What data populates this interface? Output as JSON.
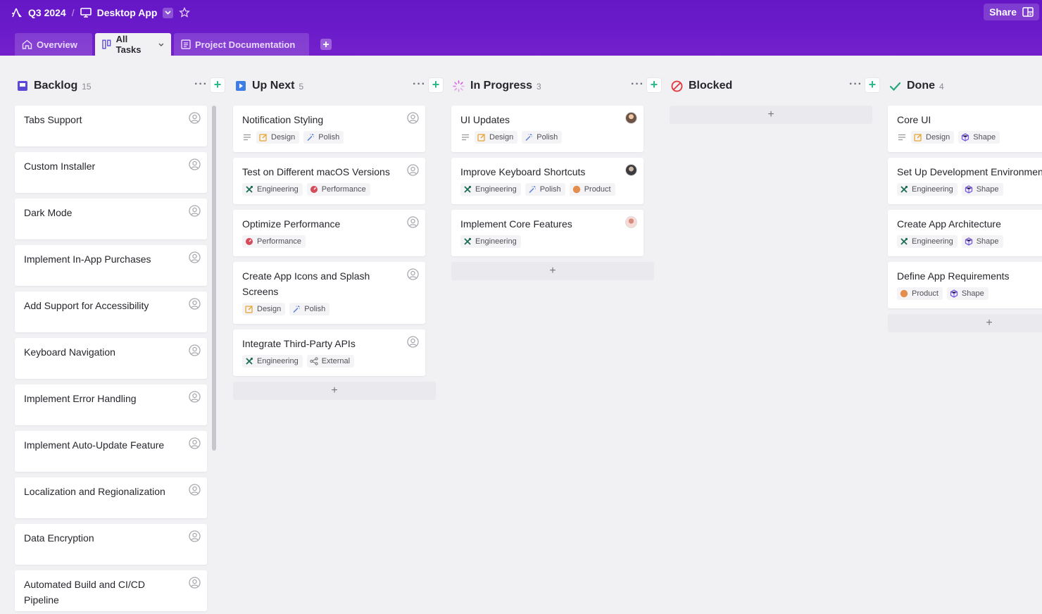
{
  "header": {
    "project": "Q3 2024",
    "separator": "/",
    "view": "Desktop App",
    "share_label": "Share"
  },
  "tabs": [
    {
      "label": "Overview"
    },
    {
      "label": "All Tasks",
      "active": true
    },
    {
      "label": "Project Documentation"
    }
  ],
  "colors": {
    "header_bg": "#6a1ac8",
    "design": "#e8a532",
    "polish": "#5c7fd6",
    "engineering": "#1c6b53",
    "performance": "#d64a5a",
    "product": "#e48d4d",
    "shape": "#7a5ce0",
    "backlog_icon": "#5b48d6",
    "upnext_icon": "#3d7ee6",
    "inprogress_icon": "#d55be0",
    "blocked_icon": "#e2343c",
    "done_icon": "#27a87c"
  },
  "columns": [
    {
      "title": "Backlog",
      "count": "15",
      "icon": "backlog-icon",
      "cards": [
        {
          "title": "Tabs Support"
        },
        {
          "title": "Custom Installer"
        },
        {
          "title": "Dark Mode"
        },
        {
          "title": "Implement In-App Purchases"
        },
        {
          "title": "Add Support for Accessibility"
        },
        {
          "title": "Keyboard Navigation"
        },
        {
          "title": "Implement Error Handling"
        },
        {
          "title": "Implement Auto-Update Feature"
        },
        {
          "title": "Localization and Regionalization"
        },
        {
          "title": "Data Encryption"
        },
        {
          "title": "Automated Build and CI/CD Pipeline"
        }
      ]
    },
    {
      "title": "Up Next",
      "count": "5",
      "icon": "play-icon",
      "cards": [
        {
          "title": "Notification Styling",
          "has_description": true,
          "tags": [
            "Design",
            "Polish"
          ]
        },
        {
          "title": "Test on Different macOS Versions",
          "tags": [
            "Engineering",
            "Performance"
          ]
        },
        {
          "title": "Optimize Performance",
          "tags": [
            "Performance"
          ]
        },
        {
          "title": "Create App Icons and Splash Screens",
          "tags": [
            "Design",
            "Polish"
          ]
        },
        {
          "title": "Integrate Third-Party APIs",
          "tags": [
            "Engineering",
            "External"
          ]
        }
      ]
    },
    {
      "title": "In Progress",
      "count": "3",
      "icon": "spinner-icon",
      "cards": [
        {
          "title": "UI Updates",
          "has_description": true,
          "tags": [
            "Design",
            "Polish"
          ],
          "avatar": "photo"
        },
        {
          "title": "Improve Keyboard Shortcuts",
          "tags": [
            "Engineering",
            "Polish",
            "Product"
          ],
          "avatar": "dark"
        },
        {
          "title": "Implement Core Features",
          "tags": [
            "Engineering"
          ],
          "avatar": "pink"
        }
      ]
    },
    {
      "title": "Blocked",
      "count": "",
      "icon": "blocked-icon",
      "cards": []
    },
    {
      "title": "Done",
      "count": "4",
      "icon": "check-icon",
      "cards": [
        {
          "title": "Core UI",
          "has_description": true,
          "tags": [
            "Design",
            "Shape"
          ]
        },
        {
          "title": "Set Up Development Environment",
          "tags": [
            "Engineering",
            "Shape"
          ]
        },
        {
          "title": "Create App Architecture",
          "tags": [
            "Engineering",
            "Shape"
          ]
        },
        {
          "title": "Define App Requirements",
          "tags": [
            "Product",
            "Shape"
          ]
        }
      ]
    }
  ]
}
